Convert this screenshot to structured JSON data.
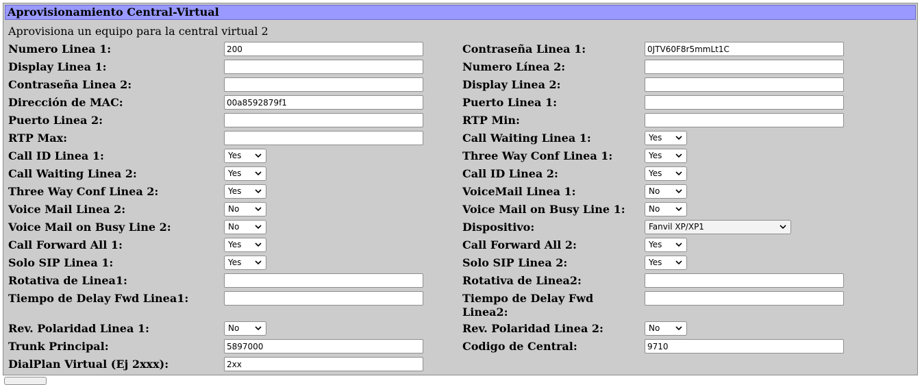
{
  "header": {
    "title": "Aprovisionamiento Central-Virtual"
  },
  "subtitle": "Aprovisiona un equipo para la central virtual 2",
  "left": [
    {
      "label": "Numero Linea 1:",
      "value": "200"
    },
    {
      "label": "Display Linea 1:",
      "value": ""
    },
    {
      "label": "Contraseña Linea 2:",
      "value": ""
    },
    {
      "label": "Dirección de MAC:",
      "value": "00a8592879f1"
    },
    {
      "label": "Puerto Linea 2:",
      "value": ""
    },
    {
      "label": "RTP Max:",
      "value": ""
    },
    {
      "label": "Call ID Linea 1:",
      "value": "Yes"
    },
    {
      "label": "Call Waiting Linea 2:",
      "value": "Yes"
    },
    {
      "label": "Three Way Conf Linea 2:",
      "value": "Yes"
    },
    {
      "label": "Voice Mail Linea 2:",
      "value": "No"
    },
    {
      "label": "Voice Mail on Busy Line 2:",
      "value": "No"
    },
    {
      "label": "Call Forward All 1:",
      "value": "Yes"
    },
    {
      "label": "Solo SIP Linea 1:",
      "value": "Yes"
    },
    {
      "label": "Rotativa de Linea1:",
      "value": ""
    },
    {
      "label": "Tiempo de Delay Fwd Linea1:",
      "value": ""
    },
    {
      "label": "Rev. Polaridad Linea 1:",
      "value": "No"
    },
    {
      "label": "Trunk Principal:",
      "value": "5897000"
    },
    {
      "label": "DialPlan Virtual (Ej 2xxx):",
      "value": "2xx"
    }
  ],
  "right": [
    {
      "label": "Contraseña Linea 1:",
      "value": "0JTV60F8r5mmLt1C"
    },
    {
      "label": "Numero Línea 2:",
      "value": ""
    },
    {
      "label": "Display Linea 2:",
      "value": ""
    },
    {
      "label": "Puerto Linea 1:",
      "value": ""
    },
    {
      "label": "RTP Min:",
      "value": ""
    },
    {
      "label": "Call Waiting Linea 1:",
      "value": "Yes"
    },
    {
      "label": "Three Way Conf Linea 1:",
      "value": "Yes"
    },
    {
      "label": "Call ID Linea 2:",
      "value": "Yes"
    },
    {
      "label": "VoiceMail Linea 1:",
      "value": "No"
    },
    {
      "label": "Voice Mail on Busy Line 1:",
      "value": "No"
    },
    {
      "label": "Dispositivo:",
      "value": "Fanvil XP/XP1"
    },
    {
      "label": "Call Forward All 2:",
      "value": "Yes"
    },
    {
      "label": "Solo SIP Linea 2:",
      "value": "Yes"
    },
    {
      "label": "Rotativa de Linea2:",
      "value": ""
    },
    {
      "label": "Tiempo de Delay Fwd Linea2:",
      "value": ""
    },
    {
      "label": "Rev. Polaridad Linea 2:",
      "value": "No"
    },
    {
      "label": "Codigo de Central:",
      "value": "9710"
    }
  ],
  "colors": {
    "header_bg": "#9999ff",
    "panel_bg": "#cccccc"
  },
  "icons": {
    "select_arrow": "chevron-down-icon"
  }
}
